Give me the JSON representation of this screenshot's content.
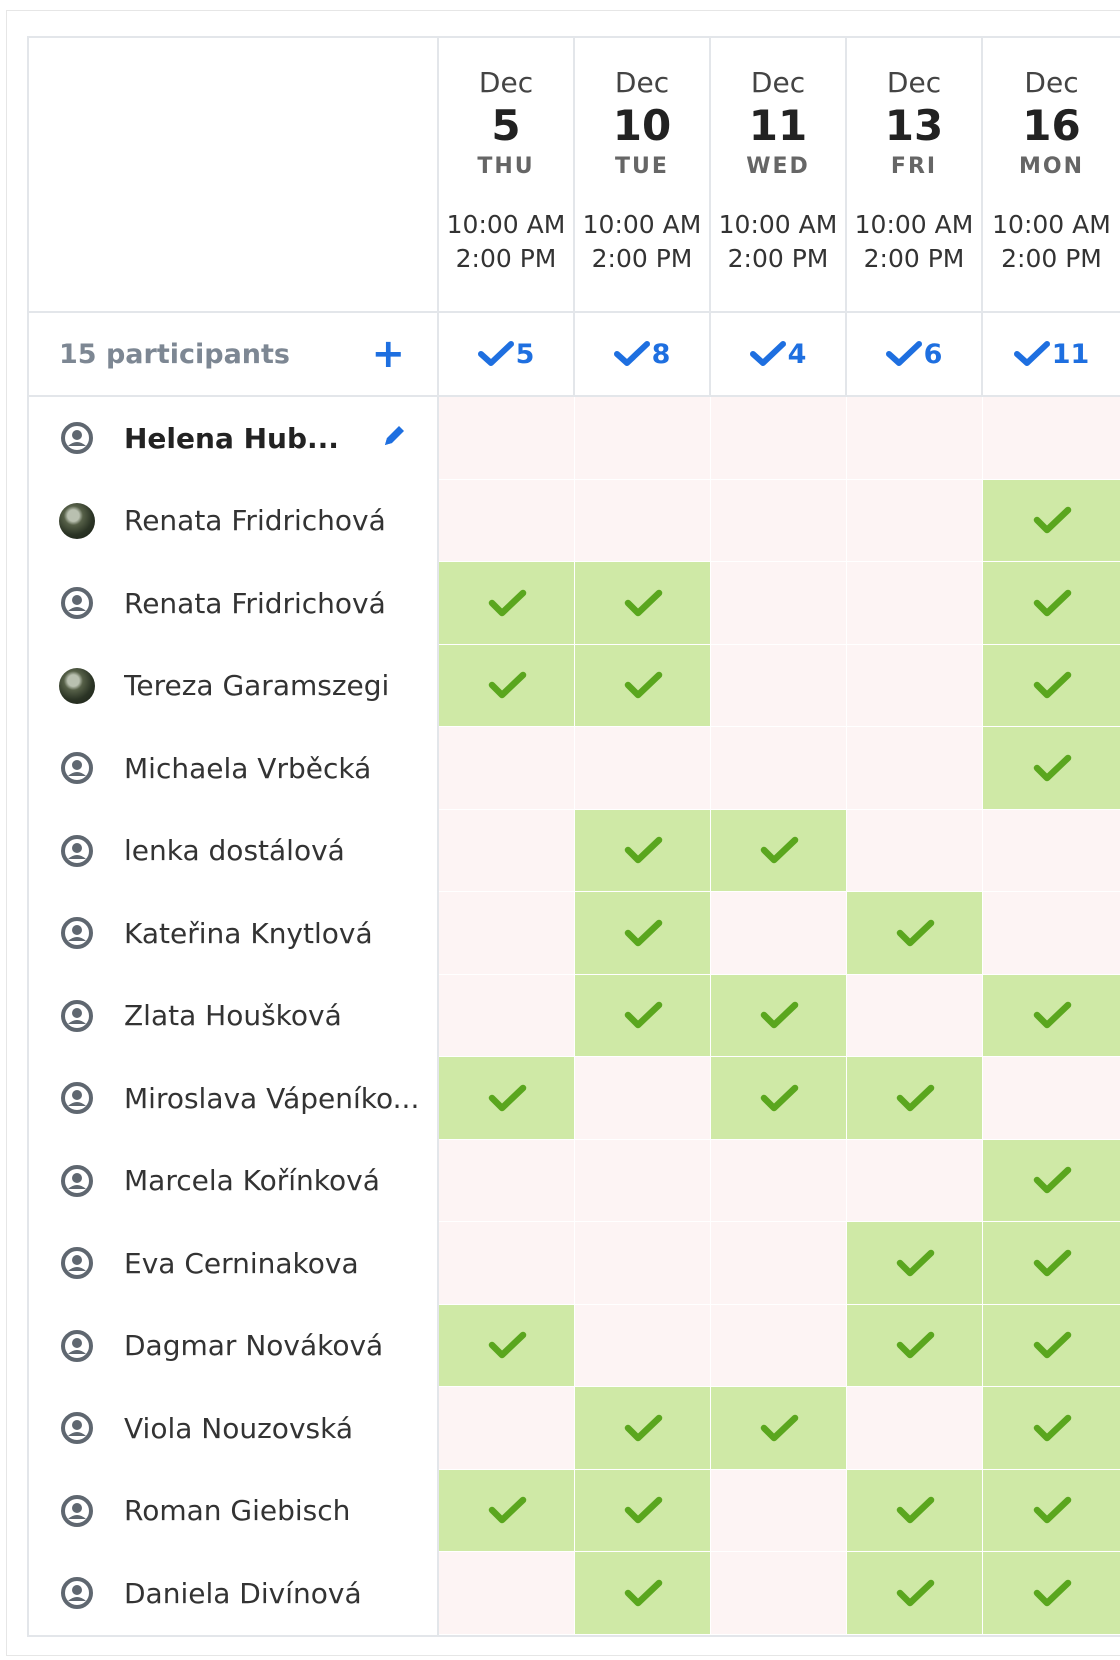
{
  "dates": [
    {
      "month": "Dec",
      "day": "5",
      "weekday": "THU",
      "start": "10:00 AM",
      "end": "2:00 PM",
      "count": "5"
    },
    {
      "month": "Dec",
      "day": "10",
      "weekday": "TUE",
      "start": "10:00 AM",
      "end": "2:00 PM",
      "count": "8"
    },
    {
      "month": "Dec",
      "day": "11",
      "weekday": "WED",
      "start": "10:00 AM",
      "end": "2:00 PM",
      "count": "4"
    },
    {
      "month": "Dec",
      "day": "13",
      "weekday": "FRI",
      "start": "10:00 AM",
      "end": "2:00 PM",
      "count": "6"
    },
    {
      "month": "Dec",
      "day": "16",
      "weekday": "MON",
      "start": "10:00 AM",
      "end": "2:00 PM",
      "count": "11"
    }
  ],
  "summary": {
    "participants_label": "15 participants",
    "add_label": "+"
  },
  "colors": {
    "accent": "#1e6fe0",
    "yes_bg": "#cfe9a6",
    "no_bg": "#fdf4f4",
    "check": "#5aa61e"
  },
  "participants": [
    {
      "name": "Helena Hub...",
      "avatar": "user-icon",
      "me": true,
      "votes": [
        0,
        0,
        0,
        0,
        0
      ]
    },
    {
      "name": "Renata Fridrichová",
      "avatar": "photo",
      "me": false,
      "votes": [
        0,
        0,
        0,
        0,
        1
      ]
    },
    {
      "name": "Renata Fridrichová",
      "avatar": "user-icon",
      "me": false,
      "votes": [
        1,
        1,
        0,
        0,
        1
      ]
    },
    {
      "name": "Tereza Garamszegi",
      "avatar": "photo",
      "me": false,
      "votes": [
        1,
        1,
        0,
        0,
        1
      ]
    },
    {
      "name": "Michaela Vrběcká",
      "avatar": "user-icon",
      "me": false,
      "votes": [
        0,
        0,
        0,
        0,
        1
      ]
    },
    {
      "name": "lenka dostálová",
      "avatar": "user-icon",
      "me": false,
      "votes": [
        0,
        1,
        1,
        0,
        0
      ]
    },
    {
      "name": "Kateřina Knytlová",
      "avatar": "user-icon",
      "me": false,
      "votes": [
        0,
        1,
        0,
        1,
        0
      ]
    },
    {
      "name": "Zlata Houšková",
      "avatar": "user-icon",
      "me": false,
      "votes": [
        0,
        1,
        1,
        0,
        1
      ]
    },
    {
      "name": "Miroslava Vápeníko...",
      "avatar": "user-icon",
      "me": false,
      "votes": [
        1,
        0,
        1,
        1,
        0
      ]
    },
    {
      "name": "Marcela Kořínková",
      "avatar": "user-icon",
      "me": false,
      "votes": [
        0,
        0,
        0,
        0,
        1
      ]
    },
    {
      "name": "Eva Cerninakova",
      "avatar": "user-icon",
      "me": false,
      "votes": [
        0,
        0,
        0,
        1,
        1
      ]
    },
    {
      "name": "Dagmar Nováková",
      "avatar": "user-icon",
      "me": false,
      "votes": [
        1,
        0,
        0,
        1,
        1
      ]
    },
    {
      "name": "Viola Nouzovská",
      "avatar": "user-icon",
      "me": false,
      "votes": [
        0,
        1,
        1,
        0,
        1
      ]
    },
    {
      "name": "Roman Giebisch",
      "avatar": "user-icon",
      "me": false,
      "votes": [
        1,
        1,
        0,
        1,
        1
      ]
    },
    {
      "name": "Daniela Divínová",
      "avatar": "user-icon",
      "me": false,
      "votes": [
        0,
        1,
        0,
        1,
        1
      ]
    }
  ]
}
